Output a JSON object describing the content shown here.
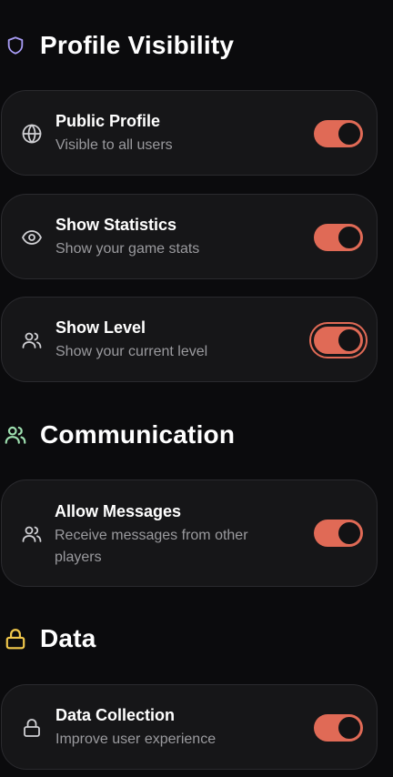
{
  "sections": {
    "profile": {
      "title": "Profile Visibility",
      "icon": "shield-icon",
      "icon_color": "#a89cf5"
    },
    "communication": {
      "title": "Communication",
      "icon": "users-icon",
      "icon_color": "#9ee0b0"
    },
    "data": {
      "title": "Data",
      "icon": "lock-icon",
      "icon_color": "#f2c94c"
    }
  },
  "settings": {
    "public_profile": {
      "title": "Public Profile",
      "desc": "Visible to all users",
      "icon": "globe-icon",
      "enabled": true
    },
    "show_statistics": {
      "title": "Show Statistics",
      "desc": "Show your game stats",
      "icon": "eye-icon",
      "enabled": true
    },
    "show_level": {
      "title": "Show Level",
      "desc": "Show your current level",
      "icon": "users-icon",
      "enabled": true,
      "focused": true
    },
    "allow_messages": {
      "title": "Allow Messages",
      "desc_line1": "Receive messages from other",
      "desc_line2": "players",
      "icon": "users-icon",
      "enabled": true
    },
    "data_collection": {
      "title": "Data Collection",
      "desc": "Improve user experience",
      "icon": "lock-icon",
      "enabled": true
    }
  },
  "colors": {
    "background": "#0b0b0d",
    "card": "#161618",
    "card_border": "#2a2a2e",
    "toggle_on": "#e06a56",
    "knob": "#121214",
    "secondary_text": "#9a9a9e"
  }
}
